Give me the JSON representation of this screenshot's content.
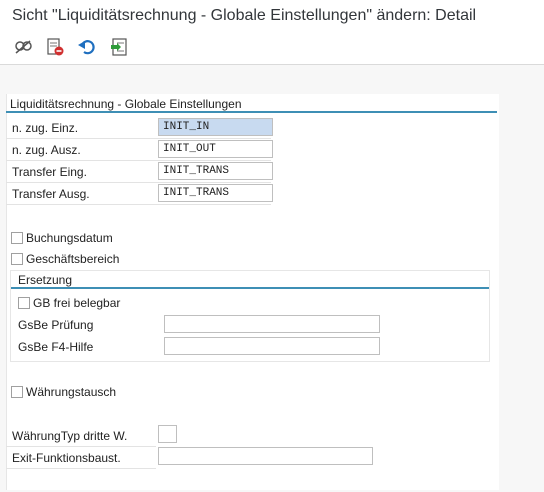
{
  "window": {
    "title": "Sicht \"Liquiditätsrechnung - Globale Einstellungen\" ändern: Detail"
  },
  "toolbar": {
    "icons": [
      "display-change-icon",
      "delete-entry-icon",
      "undo-icon",
      "transport-icon"
    ]
  },
  "section": {
    "title": "Liquiditätsrechnung - Globale Einstellungen",
    "fields": [
      {
        "label": "n. zug. Einz.",
        "value": "INIT_IN"
      },
      {
        "label": "n. zug. Ausz.",
        "value": "INIT_OUT"
      },
      {
        "label": "Transfer Eing.",
        "value": "INIT_TRANS"
      },
      {
        "label": "Transfer Ausg.",
        "value": "INIT_TRANS"
      }
    ],
    "checkboxes": {
      "buchungsdatum": {
        "label": "Buchungsdatum",
        "checked": false
      },
      "geschaeftsbereich": {
        "label": "Geschäftsbereich",
        "checked": false
      },
      "waehrungstausch": {
        "label": "Währungstausch",
        "checked": false
      }
    },
    "ersetzung": {
      "title": "Ersetzung",
      "gb_frei": {
        "label": "GB frei belegbar",
        "checked": false
      },
      "gsbe_pruefung": {
        "label": "GsBe Prüfung",
        "value": ""
      },
      "gsbe_f4": {
        "label": "GsBe F4-Hilfe",
        "value": ""
      }
    },
    "waehrungtyp": {
      "label": "WährungTyp dritte W.",
      "value": ""
    },
    "exit_fb": {
      "label": "Exit-Funktionsbaust.",
      "value": ""
    }
  }
}
